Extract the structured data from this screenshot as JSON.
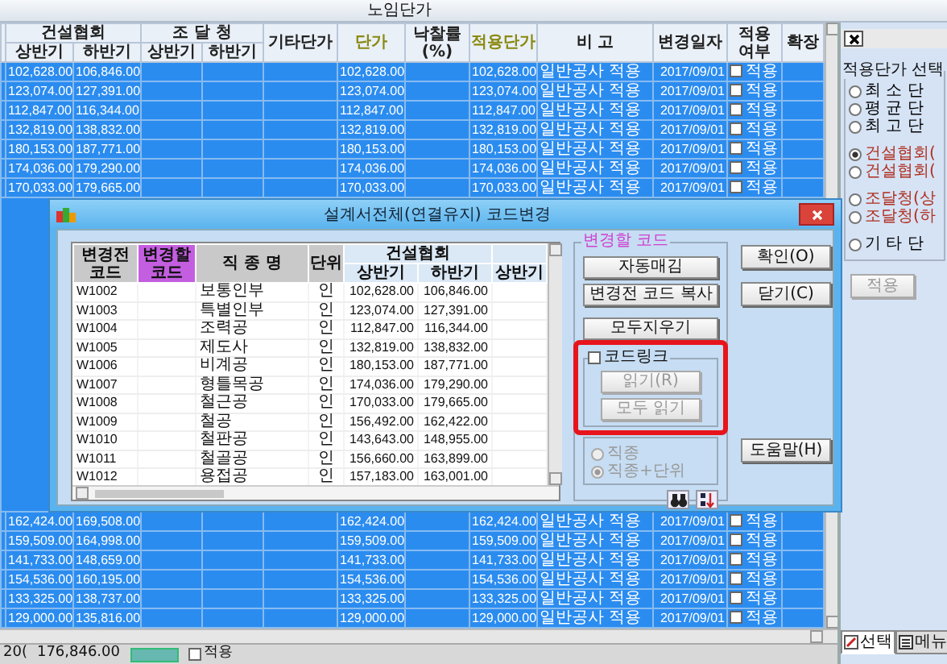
{
  "window": {
    "title": "노임단가"
  },
  "grid": {
    "column_groups": [
      {
        "label": "건설협회",
        "columns": [
          "상반기",
          "하반기"
        ]
      },
      {
        "label": "조 달 청",
        "columns": [
          "상반기",
          "하반기"
        ]
      }
    ],
    "columns": [
      {
        "label": "기타단가",
        "accent": false
      },
      {
        "label": "단가",
        "accent": true
      },
      {
        "label": "낙찰률(%)",
        "accent": false
      },
      {
        "label": "적용단가",
        "accent": true
      },
      {
        "label": "비 고",
        "accent": false
      },
      {
        "label": "변경일자",
        "accent": false
      },
      {
        "label": "적용 여부",
        "accent": false
      },
      {
        "label": "확장",
        "accent": false
      }
    ],
    "rows_top": [
      {
        "first_half": "102,628.00",
        "second_half": "106,846.00",
        "price": "102,628.00",
        "applied_price": "102,628.00",
        "note": "일반공사 적용",
        "date": "2017/09/01",
        "apply": {
          "checked": false,
          "label": "적용"
        },
        "selected": true
      },
      {
        "first_half": "123,074.00",
        "second_half": "127,391.00",
        "price": "123,074.00",
        "applied_price": "123,074.00",
        "note": "일반공사 적용",
        "date": "2017/09/01",
        "apply": {
          "checked": false,
          "label": "적용"
        },
        "selected": true
      },
      {
        "first_half": "112,847.00",
        "second_half": "116,344.00",
        "price": "112,847.00",
        "applied_price": "112,847.00",
        "note": "일반공사 적용",
        "date": "2017/09/01",
        "apply": {
          "checked": false,
          "label": "적용"
        },
        "selected": true
      },
      {
        "first_half": "132,819.00",
        "second_half": "138,832.00",
        "price": "132,819.00",
        "applied_price": "132,819.00",
        "note": "일반공사 적용",
        "date": "2017/09/01",
        "apply": {
          "checked": false,
          "label": "적용"
        },
        "selected": true
      },
      {
        "first_half": "180,153.00",
        "second_half": "187,771.00",
        "price": "180,153.00",
        "applied_price": "180,153.00",
        "note": "일반공사 적용",
        "date": "2017/09/01",
        "apply": {
          "checked": false,
          "label": "적용"
        },
        "selected": true
      },
      {
        "first_half": "174,036.00",
        "second_half": "179,290.00",
        "price": "174,036.00",
        "applied_price": "174,036.00",
        "note": "일반공사 적용",
        "date": "2017/09/01",
        "apply": {
          "checked": false,
          "label": "적용"
        },
        "selected": true
      },
      {
        "first_half": "170,033.00",
        "second_half": "179,665.00",
        "price": "170,033.00",
        "applied_price": "170,033.00",
        "note": "일반공사 적용",
        "date": "2017/09/01",
        "apply": {
          "checked": false,
          "label": "적용"
        },
        "selected": true
      }
    ],
    "rows_bottom": [
      {
        "first_half": "162,424.00",
        "second_half": "169,508.00",
        "price": "162,424.00",
        "applied_price": "162,424.00",
        "note": "일반공사 적용",
        "date": "2017/09/01",
        "apply": {
          "checked": false,
          "label": "적용"
        },
        "selected": true
      },
      {
        "first_half": "159,509.00",
        "second_half": "164,998.00",
        "price": "159,509.00",
        "applied_price": "159,509.00",
        "note": "일반공사 적용",
        "date": "2017/09/01",
        "apply": {
          "checked": false,
          "label": "적용"
        },
        "selected": true
      },
      {
        "first_half": "141,733.00",
        "second_half": "148,659.00",
        "price": "141,733.00",
        "applied_price": "141,733.00",
        "note": "일반공사 적용",
        "date": "2017/09/01",
        "apply": {
          "checked": false,
          "label": "적용"
        },
        "selected": true
      },
      {
        "first_half": "154,536.00",
        "second_half": "160,195.00",
        "price": "154,536.00",
        "applied_price": "154,536.00",
        "note": "일반공사 적용",
        "date": "2017/09/01",
        "apply": {
          "checked": false,
          "label": "적용"
        },
        "selected": true
      },
      {
        "first_half": "133,325.00",
        "second_half": "138,737.00",
        "price": "133,325.00",
        "applied_price": "133,325.00",
        "note": "일반공사 적용",
        "date": "2017/09/01",
        "apply": {
          "checked": false,
          "label": "적용"
        },
        "selected": true
      },
      {
        "first_half": "129,000.00",
        "second_half": "135,816.00",
        "price": "129,000.00",
        "applied_price": "129,000.00",
        "note": "일반공사 적용",
        "date": "2017/09/01",
        "apply": {
          "checked": false,
          "label": "적용"
        },
        "selected": true
      }
    ]
  },
  "status_bar": {
    "prefix": "20(",
    "amount": "176,846.00",
    "apply": {
      "checked": false,
      "label": "적용"
    }
  },
  "side_panel": {
    "group_title": "적용단가 선택",
    "option_groups": [
      [
        {
          "label": "최 소 단",
          "selected": false,
          "color": "#000000"
        },
        {
          "label": "평 균 단",
          "selected": false,
          "color": "#000000"
        },
        {
          "label": "최 고 단",
          "selected": false,
          "color": "#000000"
        }
      ],
      [
        {
          "label": "건설협회(",
          "selected": true,
          "color": "#b03020"
        },
        {
          "label": "건설협회(",
          "selected": false,
          "color": "#b03020"
        }
      ],
      [
        {
          "label": "조달청(상",
          "selected": false,
          "color": "#b03020"
        },
        {
          "label": "조달청(하",
          "selected": false,
          "color": "#b03020"
        }
      ],
      [
        {
          "label": "기 타 단",
          "selected": false,
          "color": "#000000"
        }
      ]
    ],
    "apply_button": {
      "label": "적용",
      "disabled": true
    },
    "tabs": [
      {
        "label": "선택",
        "selected": true
      },
      {
        "label": "메뉴",
        "selected": false
      }
    ]
  },
  "dialog": {
    "title": "설계서전체(연결유지) 코드변경",
    "table": {
      "columns": [
        {
          "label": "변경전 코드",
          "kind": "plain"
        },
        {
          "label": "변경할 코드",
          "kind": "target"
        },
        {
          "label": "직 종 명",
          "kind": "plain"
        },
        {
          "label": "단위",
          "kind": "plain"
        }
      ],
      "column_group": {
        "label": "건설협회",
        "columns": [
          "상반기",
          "하반기"
        ]
      },
      "extra_column": "상반기",
      "rows": [
        {
          "old_code": "W1002",
          "job": "보통인부",
          "unit": "인",
          "first_half": "102,628.00",
          "second_half": "106,846.00"
        },
        {
          "old_code": "W1003",
          "job": "특별인부",
          "unit": "인",
          "first_half": "123,074.00",
          "second_half": "127,391.00"
        },
        {
          "old_code": "W1004",
          "job": "조력공",
          "unit": "인",
          "first_half": "112,847.00",
          "second_half": "116,344.00"
        },
        {
          "old_code": "W1005",
          "job": "제도사",
          "unit": "인",
          "first_half": "132,819.00",
          "second_half": "138,832.00"
        },
        {
          "old_code": "W1006",
          "job": "비계공",
          "unit": "인",
          "first_half": "180,153.00",
          "second_half": "187,771.00"
        },
        {
          "old_code": "W1007",
          "job": "형틀목공",
          "unit": "인",
          "first_half": "174,036.00",
          "second_half": "179,290.00"
        },
        {
          "old_code": "W1008",
          "job": "철근공",
          "unit": "인",
          "first_half": "170,033.00",
          "second_half": "179,665.00"
        },
        {
          "old_code": "W1009",
          "job": "철공",
          "unit": "인",
          "first_half": "156,492.00",
          "second_half": "162,422.00"
        },
        {
          "old_code": "W1010",
          "job": "철판공",
          "unit": "인",
          "first_half": "143,643.00",
          "second_half": "148,955.00"
        },
        {
          "old_code": "W1011",
          "job": "철골공",
          "unit": "인",
          "first_half": "156,660.00",
          "second_half": "163,899.00"
        },
        {
          "old_code": "W1012",
          "job": "용접공",
          "unit": "인",
          "first_half": "157,183.00",
          "second_half": "163,001.00"
        }
      ]
    },
    "code_group": {
      "title": "변경할 코드",
      "buttons": [
        "자동매김",
        "변경전 코드 복사",
        "모두지우기"
      ],
      "link": {
        "label": "코드링크",
        "checked": false,
        "buttons": [
          {
            "label": "읽기(R)",
            "disabled": true
          },
          {
            "label": "모두 읽기",
            "disabled": true
          }
        ]
      },
      "match_options": [
        {
          "label": "직종",
          "selected": false,
          "disabled": true
        },
        {
          "label": "직종+단위",
          "selected": true,
          "disabled": true
        }
      ]
    },
    "buttons": [
      "확인(O)",
      "닫기(C)",
      "도움말(H)"
    ]
  }
}
